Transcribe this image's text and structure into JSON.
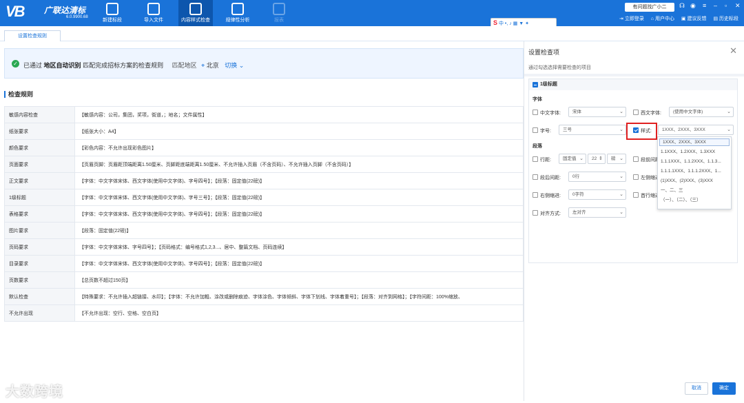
{
  "app": {
    "logo": "VB",
    "brand": "广联达清标",
    "version": "6.0.9900.68"
  },
  "nav": [
    {
      "label": "新建标段"
    },
    {
      "label": "导入文件"
    },
    {
      "label": "内容样式检查"
    },
    {
      "label": "规律性分析"
    },
    {
      "label": "报表"
    }
  ],
  "top": {
    "help": "有问题找广小二",
    "login": "立即登录",
    "user_center": "用户中心",
    "feedback": "建议反馈",
    "history": "历史标段"
  },
  "tab": {
    "label": "设置检查规则"
  },
  "banner": {
    "prefix": "已通过",
    "method": "地区自动识别",
    "suffix": "匹配完成招标方案的检查规则",
    "region_label": "匹配地区",
    "region": "北京",
    "switch": "切换"
  },
  "rules": {
    "title": "检查规则",
    "rows": [
      {
        "k": "敏感内容检查",
        "v": "【敏感内容：公司，集团，奖项，街道，；地名；文件属性】"
      },
      {
        "k": "纸张要求",
        "v": "【纸张大小：A4】"
      },
      {
        "k": "颜色要求",
        "v": "【彩色内容：不允许出现彩色图片】"
      },
      {
        "k": "页面要求",
        "v": "【页眉页脚：页眉距顶端距离1.50厘米、页脚距底端距离1.50厘米、不允许插入页眉（不含页码）、不允许插入页脚（不含页码）】"
      },
      {
        "k": "正文要求",
        "v": "【字体：中文字体宋体、西文字体(使用中文字体)、字号四号】；【段落：固定值(22磅)】"
      },
      {
        "k": "1级标题",
        "v": "【字体：中文字体宋体、西文字体(使用中文字体)、字号三号】；【段落：固定值(22磅)】"
      },
      {
        "k": "表格要求",
        "v": "【字体：中文字体宋体、西文字体(使用中文字体)、字号四号】；【段落：固定值(22磅)】"
      },
      {
        "k": "图片要求",
        "v": "【段落：固定值(22磅)】"
      },
      {
        "k": "页码要求",
        "v": "【字体：中文字体宋体、字号四号】；【页码格式：编号格式1,2,3...、居中、整篇文档、页码连续】"
      },
      {
        "k": "目录要求",
        "v": "【字体：中文字体宋体、西文字体(使用中文字体)、字号四号】；【段落：固定值(22磅)】"
      },
      {
        "k": "页数要求",
        "v": "【总页数不超过150页】"
      },
      {
        "k": "默认检查",
        "v": "【特殊要求：不允许插入超链接、水印】；【字体：不允许加粗、涂改或删除痕迹、字体涂色、字体倾斜、字体下划线、字体着重号】；【段落：对齐到网格】；【字符间距：100%缩放、"
      },
      {
        "k": "不允许出现",
        "v": "【不允许出现：空行、空格、空白页】"
      }
    ]
  },
  "panel": {
    "title": "设置检查项",
    "subtitle": "通过勾选选择需要检查的项目",
    "section": "1级标题",
    "font_group": "字体",
    "para_group": "段落",
    "cn_font_label": "中文字体:",
    "cn_font": "宋体",
    "en_font_label": "西文字体:",
    "en_font": "(使用中文字体)",
    "size_label": "字号:",
    "size": "三号",
    "style_label": "样式:",
    "style": "1XXX、2XXX、3XXX",
    "line_label": "行距:",
    "line_mode": "固定值",
    "line_value": "22",
    "line_unit": "磅",
    "before_label": "段前间距",
    "after_label": "段后间距:",
    "after": "0行",
    "left_label": "左侧缩进",
    "right_label": "右侧缩进:",
    "right": "0字符",
    "first_label": "首行缩进",
    "align_label": "对齐方式:",
    "align": "左对齐",
    "style_options": [
      "1XXX、2XXX、3XXX",
      "1.1XXX、1.2XXX、1.3XXX",
      "1.1.1XXX、1.1.2XXX、1.1.3...",
      "1.1.1.1XXX、1.1.1.2XXX、1...",
      "(1)XXX、(2)XXX、(3)XXX",
      "一、二、三",
      "（一）、（二）、（三）"
    ],
    "cancel": "取消",
    "ok": "确定"
  },
  "watermark": "大数跨境"
}
